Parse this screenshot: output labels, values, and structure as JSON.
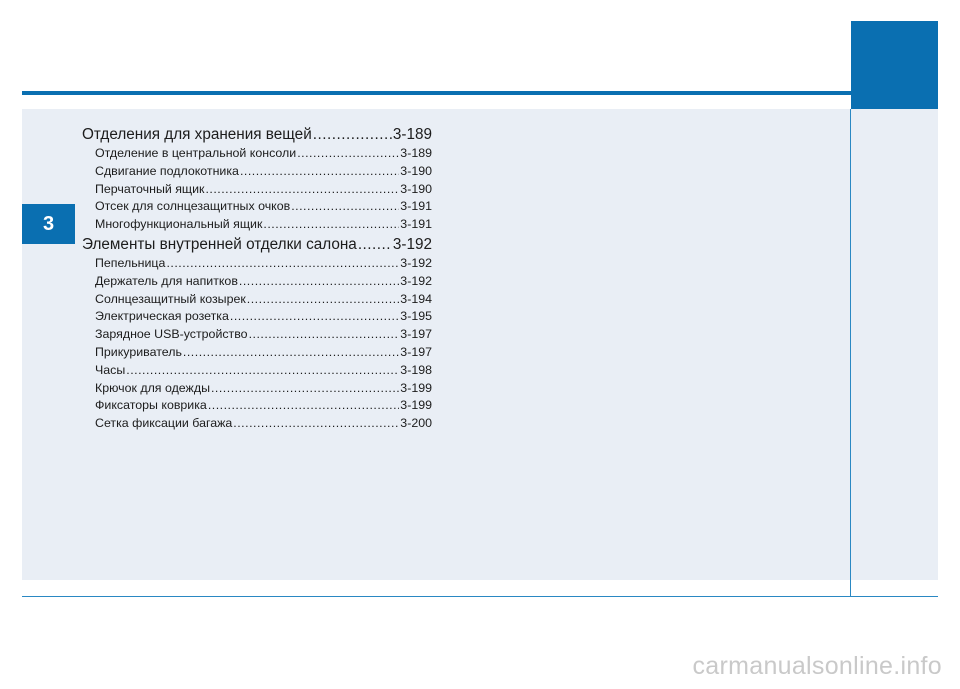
{
  "chapter": "3",
  "toc": [
    {
      "kind": "section",
      "title": "Отделения для хранения вещей",
      "page": "3-189"
    },
    {
      "kind": "sub",
      "title": "Отделение в центральной консоли",
      "page": "3-189"
    },
    {
      "kind": "sub",
      "title": "Сдвигание подлокотника",
      "page": "3-190"
    },
    {
      "kind": "sub",
      "title": "Перчаточный ящик",
      "page": "3-190"
    },
    {
      "kind": "sub",
      "title": "Отсек для солнцезащитных очков",
      "page": "3-191"
    },
    {
      "kind": "sub",
      "title": "Многофункциональный ящик",
      "page": "3-191"
    },
    {
      "kind": "section",
      "title": "Элементы внутренней отделки салона",
      "page": "3-192"
    },
    {
      "kind": "sub",
      "title": "Пепельница",
      "page": "3-192"
    },
    {
      "kind": "sub",
      "title": "Держатель для напитков",
      "page": "3-192"
    },
    {
      "kind": "sub",
      "title": "Солнцезащитный козырек",
      "page": "3-194"
    },
    {
      "kind": "sub",
      "title": "Электрическая розетка",
      "page": "3-195"
    },
    {
      "kind": "sub",
      "title": "Зарядное USB-устройство",
      "page": "3-197"
    },
    {
      "kind": "sub",
      "title": "Прикуриватель",
      "page": "3-197"
    },
    {
      "kind": "sub",
      "title": "Часы",
      "page": "3-198"
    },
    {
      "kind": "sub",
      "title": "Крючок для одежды",
      "page": "3-199"
    },
    {
      "kind": "sub",
      "title": "Фиксаторы коврика",
      "page": "3-199"
    },
    {
      "kind": "sub",
      "title": "Сетка фиксации багажа",
      "page": "3-200"
    }
  ],
  "watermark": "carmanualsonline.info",
  "colors": {
    "accent": "#0a6fb1",
    "panel": "#e9eef5",
    "rule": "#2a88c3",
    "text": "#1c1c1c",
    "watermark": "#c9c9c9"
  }
}
